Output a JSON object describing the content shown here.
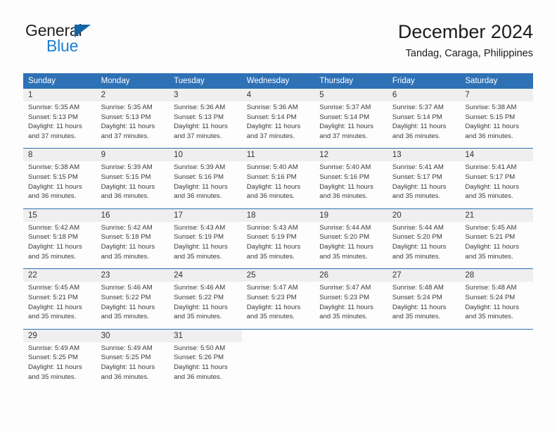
{
  "brand": {
    "name_top": "General",
    "name_bottom": "Blue",
    "flag_icon": "triangle-flag-icon",
    "color_top": "#231f20",
    "color_bottom": "#1b7fd4",
    "color_flag": "#1464a5"
  },
  "header": {
    "title": "December 2024",
    "subtitle": "Tandag, Caraga, Philippines"
  },
  "theme": {
    "header_bg": "#2e71b5",
    "header_text": "#ffffff",
    "daynum_bg": "#efefef",
    "cell_bg": "#fdfdfd",
    "rule_color": "#2e71b5"
  },
  "calendar": {
    "weekday_headers": [
      "Sunday",
      "Monday",
      "Tuesday",
      "Wednesday",
      "Thursday",
      "Friday",
      "Saturday"
    ],
    "weeks": [
      [
        {
          "day": "1",
          "lines": [
            "Sunrise: 5:35 AM",
            "Sunset: 5:13 PM",
            "Daylight: 11 hours",
            "and 37 minutes."
          ]
        },
        {
          "day": "2",
          "lines": [
            "Sunrise: 5:35 AM",
            "Sunset: 5:13 PM",
            "Daylight: 11 hours",
            "and 37 minutes."
          ]
        },
        {
          "day": "3",
          "lines": [
            "Sunrise: 5:36 AM",
            "Sunset: 5:13 PM",
            "Daylight: 11 hours",
            "and 37 minutes."
          ]
        },
        {
          "day": "4",
          "lines": [
            "Sunrise: 5:36 AM",
            "Sunset: 5:14 PM",
            "Daylight: 11 hours",
            "and 37 minutes."
          ]
        },
        {
          "day": "5",
          "lines": [
            "Sunrise: 5:37 AM",
            "Sunset: 5:14 PM",
            "Daylight: 11 hours",
            "and 37 minutes."
          ]
        },
        {
          "day": "6",
          "lines": [
            "Sunrise: 5:37 AM",
            "Sunset: 5:14 PM",
            "Daylight: 11 hours",
            "and 36 minutes."
          ]
        },
        {
          "day": "7",
          "lines": [
            "Sunrise: 5:38 AM",
            "Sunset: 5:15 PM",
            "Daylight: 11 hours",
            "and 36 minutes."
          ]
        }
      ],
      [
        {
          "day": "8",
          "lines": [
            "Sunrise: 5:38 AM",
            "Sunset: 5:15 PM",
            "Daylight: 11 hours",
            "and 36 minutes."
          ]
        },
        {
          "day": "9",
          "lines": [
            "Sunrise: 5:39 AM",
            "Sunset: 5:15 PM",
            "Daylight: 11 hours",
            "and 36 minutes."
          ]
        },
        {
          "day": "10",
          "lines": [
            "Sunrise: 5:39 AM",
            "Sunset: 5:16 PM",
            "Daylight: 11 hours",
            "and 36 minutes."
          ]
        },
        {
          "day": "11",
          "lines": [
            "Sunrise: 5:40 AM",
            "Sunset: 5:16 PM",
            "Daylight: 11 hours",
            "and 36 minutes."
          ]
        },
        {
          "day": "12",
          "lines": [
            "Sunrise: 5:40 AM",
            "Sunset: 5:16 PM",
            "Daylight: 11 hours",
            "and 36 minutes."
          ]
        },
        {
          "day": "13",
          "lines": [
            "Sunrise: 5:41 AM",
            "Sunset: 5:17 PM",
            "Daylight: 11 hours",
            "and 35 minutes."
          ]
        },
        {
          "day": "14",
          "lines": [
            "Sunrise: 5:41 AM",
            "Sunset: 5:17 PM",
            "Daylight: 11 hours",
            "and 35 minutes."
          ]
        }
      ],
      [
        {
          "day": "15",
          "lines": [
            "Sunrise: 5:42 AM",
            "Sunset: 5:18 PM",
            "Daylight: 11 hours",
            "and 35 minutes."
          ]
        },
        {
          "day": "16",
          "lines": [
            "Sunrise: 5:42 AM",
            "Sunset: 5:18 PM",
            "Daylight: 11 hours",
            "and 35 minutes."
          ]
        },
        {
          "day": "17",
          "lines": [
            "Sunrise: 5:43 AM",
            "Sunset: 5:19 PM",
            "Daylight: 11 hours",
            "and 35 minutes."
          ]
        },
        {
          "day": "18",
          "lines": [
            "Sunrise: 5:43 AM",
            "Sunset: 5:19 PM",
            "Daylight: 11 hours",
            "and 35 minutes."
          ]
        },
        {
          "day": "19",
          "lines": [
            "Sunrise: 5:44 AM",
            "Sunset: 5:20 PM",
            "Daylight: 11 hours",
            "and 35 minutes."
          ]
        },
        {
          "day": "20",
          "lines": [
            "Sunrise: 5:44 AM",
            "Sunset: 5:20 PM",
            "Daylight: 11 hours",
            "and 35 minutes."
          ]
        },
        {
          "day": "21",
          "lines": [
            "Sunrise: 5:45 AM",
            "Sunset: 5:21 PM",
            "Daylight: 11 hours",
            "and 35 minutes."
          ]
        }
      ],
      [
        {
          "day": "22",
          "lines": [
            "Sunrise: 5:45 AM",
            "Sunset: 5:21 PM",
            "Daylight: 11 hours",
            "and 35 minutes."
          ]
        },
        {
          "day": "23",
          "lines": [
            "Sunrise: 5:46 AM",
            "Sunset: 5:22 PM",
            "Daylight: 11 hours",
            "and 35 minutes."
          ]
        },
        {
          "day": "24",
          "lines": [
            "Sunrise: 5:46 AM",
            "Sunset: 5:22 PM",
            "Daylight: 11 hours",
            "and 35 minutes."
          ]
        },
        {
          "day": "25",
          "lines": [
            "Sunrise: 5:47 AM",
            "Sunset: 5:23 PM",
            "Daylight: 11 hours",
            "and 35 minutes."
          ]
        },
        {
          "day": "26",
          "lines": [
            "Sunrise: 5:47 AM",
            "Sunset: 5:23 PM",
            "Daylight: 11 hours",
            "and 35 minutes."
          ]
        },
        {
          "day": "27",
          "lines": [
            "Sunrise: 5:48 AM",
            "Sunset: 5:24 PM",
            "Daylight: 11 hours",
            "and 35 minutes."
          ]
        },
        {
          "day": "28",
          "lines": [
            "Sunrise: 5:48 AM",
            "Sunset: 5:24 PM",
            "Daylight: 11 hours",
            "and 35 minutes."
          ]
        }
      ],
      [
        {
          "day": "29",
          "lines": [
            "Sunrise: 5:49 AM",
            "Sunset: 5:25 PM",
            "Daylight: 11 hours",
            "and 35 minutes."
          ]
        },
        {
          "day": "30",
          "lines": [
            "Sunrise: 5:49 AM",
            "Sunset: 5:25 PM",
            "Daylight: 11 hours",
            "and 36 minutes."
          ]
        },
        {
          "day": "31",
          "lines": [
            "Sunrise: 5:50 AM",
            "Sunset: 5:26 PM",
            "Daylight: 11 hours",
            "and 36 minutes."
          ]
        },
        {
          "day": "",
          "lines": []
        },
        {
          "day": "",
          "lines": []
        },
        {
          "day": "",
          "lines": []
        },
        {
          "day": "",
          "lines": []
        }
      ]
    ]
  }
}
